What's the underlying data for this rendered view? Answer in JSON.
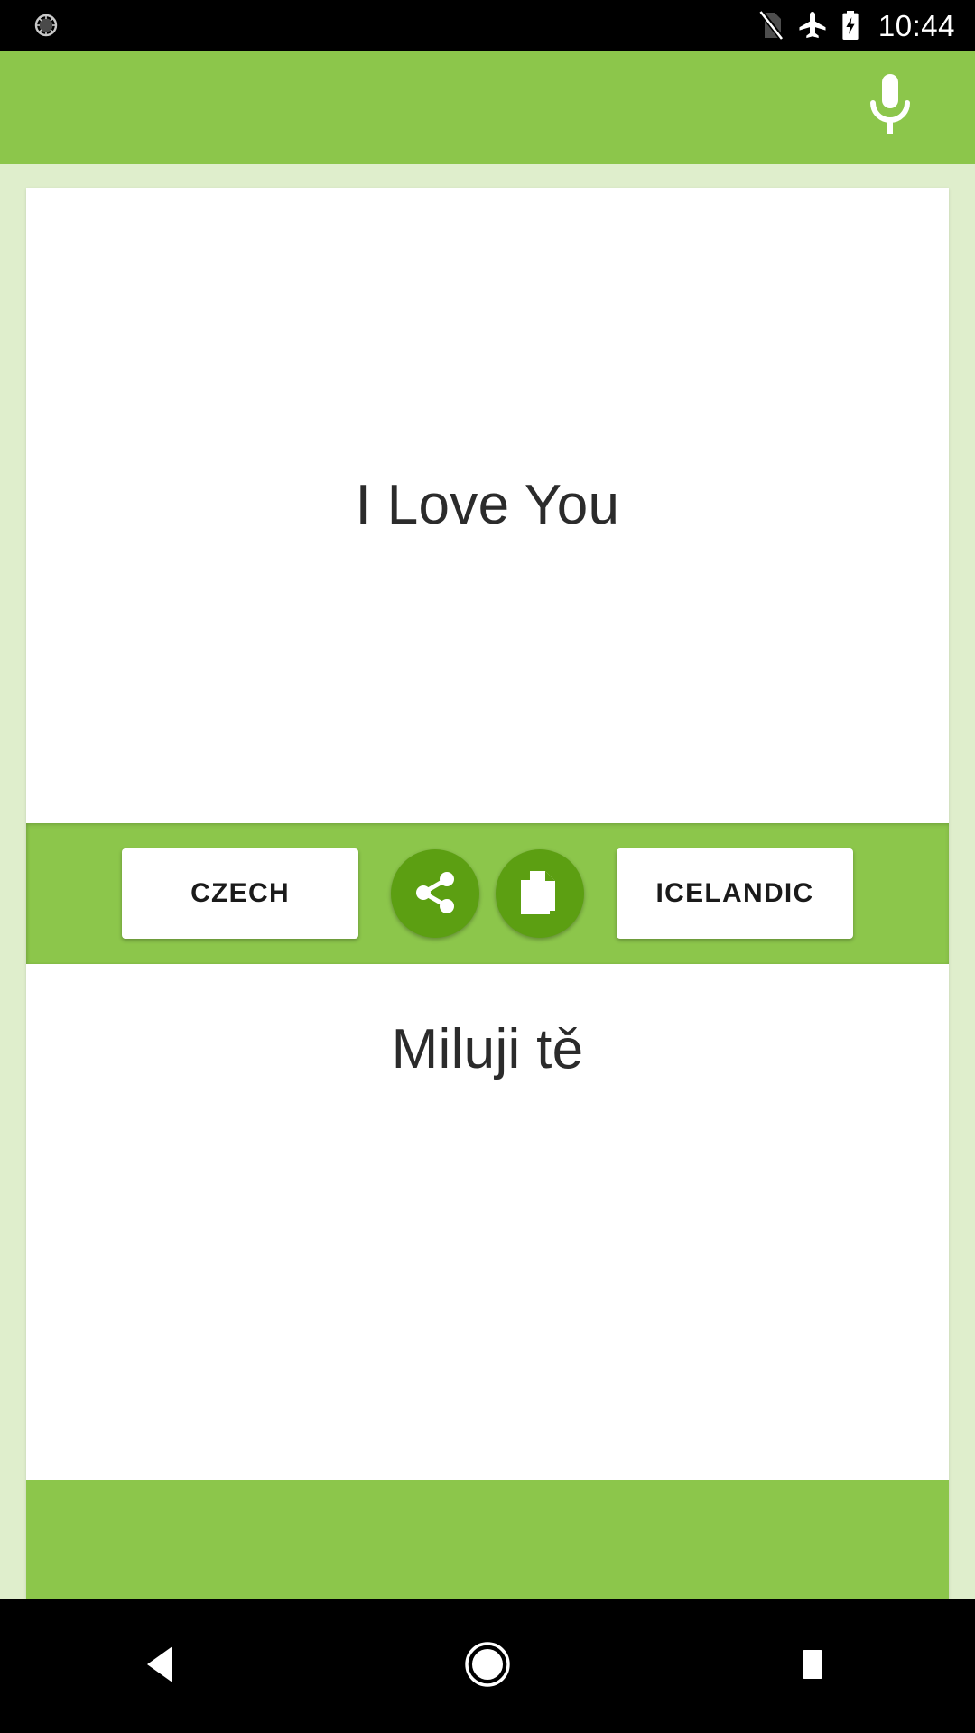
{
  "status_bar": {
    "time": "10:44",
    "left_icons": [
      {
        "name": "app-notification-icon",
        "glyph": "sun-dial"
      }
    ],
    "right_icons": [
      {
        "name": "no-sim-icon",
        "label": "no SIM card"
      },
      {
        "name": "airplane-mode-icon",
        "label": "airplane mode"
      },
      {
        "name": "battery-charging-icon",
        "label": "battery charging"
      }
    ],
    "background_color": "#000000",
    "foreground_color": "#ffffff"
  },
  "app_bar": {
    "title": "",
    "background_color": "#8cc64b",
    "mic_icon_name": "microphone-icon",
    "mic_icon_label": "Voice input"
  },
  "theme": {
    "primary_green": "#8cc64b",
    "dark_green": "#5c9f12",
    "page_background": "#dfeecc",
    "card_background": "#ffffff",
    "text_color": "#2b2b2b"
  },
  "translation": {
    "source_text": "I Love You",
    "target_text": "Miluji tě"
  },
  "actions": {
    "source_language": "CZECH",
    "target_language": "ICELANDIC",
    "share_icon_name": "share-icon",
    "share_label": "Share",
    "copy_icon_name": "copy-icon",
    "copy_label": "Copy"
  },
  "nav_bar": {
    "back_label": "Back",
    "home_label": "Home",
    "recents_label": "Recent apps"
  }
}
